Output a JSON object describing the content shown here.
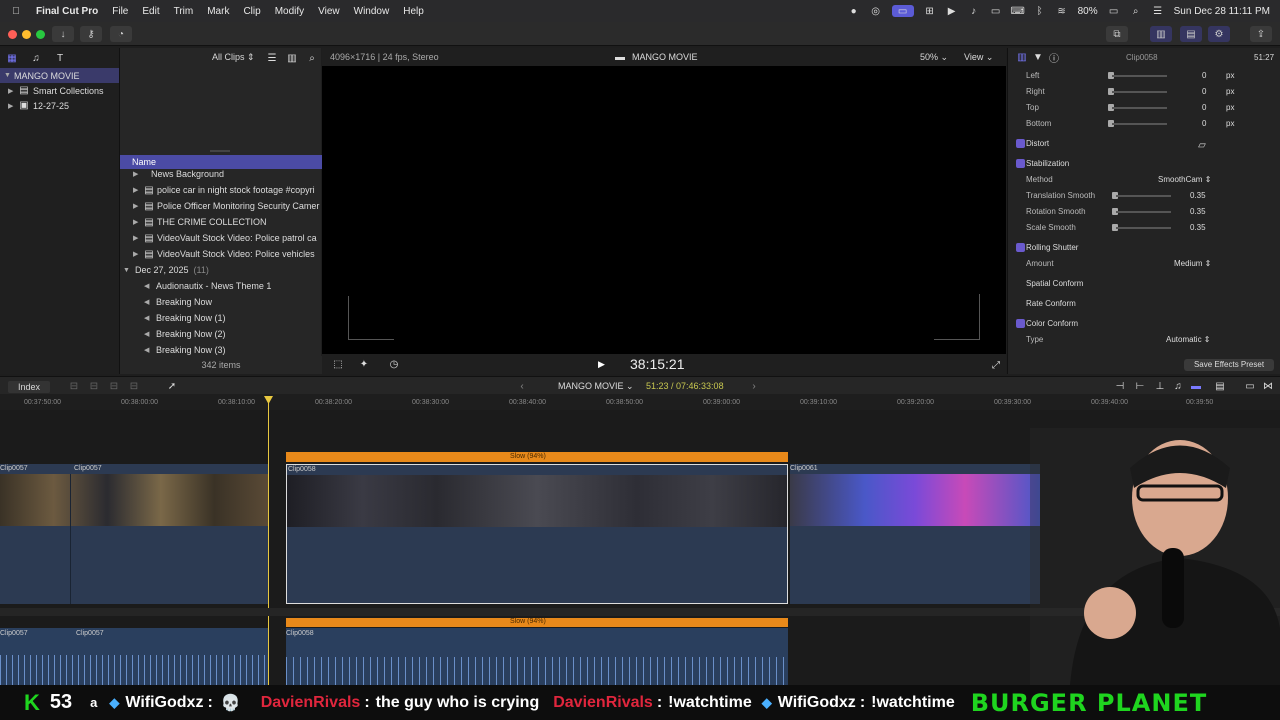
{
  "menubar": {
    "app_name": "Final Cut Pro",
    "items": [
      "File",
      "Edit",
      "Trim",
      "Mark",
      "Clip",
      "Modify",
      "View",
      "Window",
      "Help"
    ],
    "battery": "80%",
    "datetime": "Sun Dec 28  11:11 PM"
  },
  "library": {
    "items": [
      {
        "label": "MANGO MOVIE",
        "selected": true
      },
      {
        "label": "Smart Collections",
        "selected": false
      },
      {
        "label": "12-27-25",
        "selected": false
      }
    ]
  },
  "browser": {
    "filter_label": "All Clips",
    "column_name": "Name",
    "rows": [
      "News Background",
      "police  car in night stock footage #copyri",
      "Police Officer Monitoring Security Camer",
      "THE CRIME COLLECTION",
      "VideoVault Stock Video:   Police patrol ca",
      "VideoVault Stock Video:   Police vehicles"
    ],
    "group_label": "Dec 27, 2025",
    "group_count": "(11)",
    "group_rows": [
      "Audionautix - News Theme 1",
      "Breaking Now",
      "Breaking Now (1)",
      "Breaking Now (2)",
      "Breaking Now (3)"
    ],
    "item_count": "342 items"
  },
  "viewer": {
    "format": "4096×1716 | 24 fps, Stereo",
    "title": "MANGO MOVIE",
    "zoom": "50%",
    "view_label": "View",
    "timecode": "38:15:21"
  },
  "inspector": {
    "clip_name": "Clip0058",
    "duration": "51:27",
    "crop_rows": [
      {
        "label": "Left",
        "value": "0",
        "unit": "px"
      },
      {
        "label": "Right",
        "value": "0",
        "unit": "px"
      },
      {
        "label": "Top",
        "value": "0",
        "unit": "px"
      },
      {
        "label": "Bottom",
        "value": "0",
        "unit": "px"
      }
    ],
    "distort_label": "Distort",
    "stabilization_label": "Stabilization",
    "method_label": "Method",
    "method_value": "SmoothCam",
    "stab_rows": [
      {
        "label": "Translation Smooth",
        "value": "0.35"
      },
      {
        "label": "Rotation Smooth",
        "value": "0.35"
      },
      {
        "label": "Scale Smooth",
        "value": "0.35"
      }
    ],
    "rolling_label": "Rolling Shutter",
    "amount_label": "Amount",
    "amount_value": "Medium",
    "spatial_label": "Spatial Conform",
    "rate_label": "Rate Conform",
    "color_conform_label": "Color Conform",
    "type_label": "Type",
    "type_value": "Automatic",
    "save_preset": "Save Effects Preset"
  },
  "timeline": {
    "index_label": "Index",
    "project_name": "MANGO MOVIE",
    "duration_info": "51:23 / 07:46:33:08",
    "ruler": [
      "00:37:50:00",
      "00:38:00:00",
      "00:38:10:00",
      "00:38:20:00",
      "00:38:30:00",
      "00:38:40:00",
      "00:38:50:00",
      "00:39:00:00",
      "00:39:10:00",
      "00:39:20:00",
      "00:39:30:00",
      "00:39:40:00",
      "00:39:50"
    ],
    "clips": [
      {
        "name": "Clip0057"
      },
      {
        "name": "Clip0057"
      },
      {
        "name": "Clip0058"
      },
      {
        "name": "Clip0061"
      }
    ],
    "speed_label": "Slow (94%)",
    "audio_clips": [
      "Clip0057",
      "Clip0057",
      "Clip0058"
    ]
  },
  "chat": {
    "counter": "53",
    "partial": "a",
    "messages": [
      {
        "user": "WifiGodxz",
        "sep": ":",
        "text": "💀",
        "color": "#ffffff"
      },
      {
        "user": "DavienRivals",
        "sep": ":",
        "text": "the guy who is crying",
        "color": "#e0263d"
      },
      {
        "user": "DavienRivals",
        "sep": ":",
        "text": "!watchtime",
        "color": "#e0263d"
      },
      {
        "user": "WifiGodxz",
        "sep": ":",
        "text": "!watchtime",
        "color": "#ffffff"
      }
    ],
    "brand": "BURGER PLANET",
    "brand_color": "#1fd51f"
  },
  "colors": {
    "accent": "#5b5bd6",
    "clip_header": "#e8891a",
    "chat_green": "#1fd51f"
  }
}
